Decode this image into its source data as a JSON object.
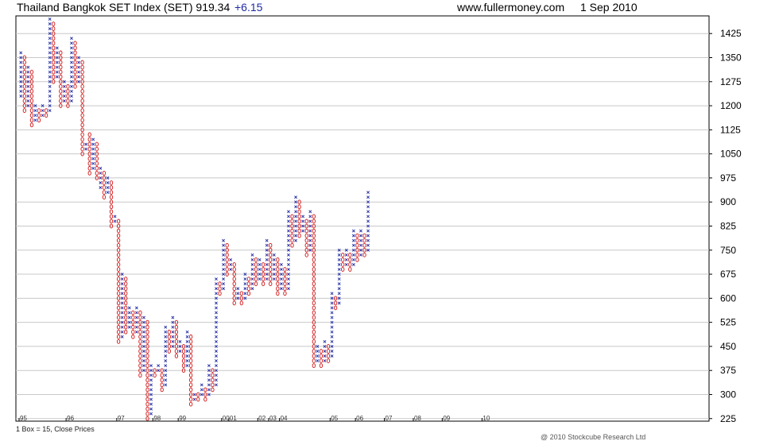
{
  "header": {
    "title": "Thailand Bangkok SET Index (SET) 919.34",
    "change": "+6.15",
    "source": "www.fullermoney.com",
    "date": "1 Sep 2010"
  },
  "footer": {
    "box_note": "1 Box = 15, Close Prices",
    "copyright": "@ 2010 Stockcube Research Ltd"
  },
  "colors": {
    "x_col": "#1f2aa3",
    "o_col": "#d01010",
    "grid": "#c8c8c8",
    "axis": "#000000"
  },
  "chart_data": {
    "type": "point-and-figure",
    "box_size": 15,
    "ylim": [
      217,
      1480
    ],
    "y_ticks": [
      225,
      300,
      375,
      450,
      525,
      600,
      675,
      750,
      825,
      900,
      975,
      1050,
      1125,
      1200,
      1275,
      1350,
      1425
    ],
    "x_ticks": [
      "95",
      "96",
      "97",
      "98",
      "99",
      "00",
      "01",
      "02",
      "03",
      "04",
      "05",
      "06",
      "07",
      "08",
      "09",
      "10"
    ],
    "x_tick_col": [
      0,
      13,
      27,
      37,
      44,
      56,
      58,
      66,
      69,
      72,
      86,
      93,
      101,
      109,
      117,
      128
    ],
    "columns": [
      {
        "type": "X",
        "low": 1230,
        "high": 1365
      },
      {
        "type": "O",
        "low": 1185,
        "high": 1350
      },
      {
        "type": "X",
        "low": 1200,
        "high": 1320
      },
      {
        "type": "O",
        "low": 1140,
        "high": 1305
      },
      {
        "type": "X",
        "low": 1155,
        "high": 1200
      },
      {
        "type": "O",
        "low": 1155,
        "high": 1185
      },
      {
        "type": "X",
        "low": 1170,
        "high": 1200
      },
      {
        "type": "O",
        "low": 1170,
        "high": 1185
      },
      {
        "type": "X",
        "low": 1185,
        "high": 1470
      },
      {
        "type": "O",
        "low": 1275,
        "high": 1455
      },
      {
        "type": "X",
        "low": 1290,
        "high": 1380
      },
      {
        "type": "O",
        "low": 1200,
        "high": 1365
      },
      {
        "type": "X",
        "low": 1215,
        "high": 1275
      },
      {
        "type": "O",
        "low": 1200,
        "high": 1260
      },
      {
        "type": "X",
        "low": 1215,
        "high": 1410
      },
      {
        "type": "O",
        "low": 1260,
        "high": 1395
      },
      {
        "type": "X",
        "low": 1275,
        "high": 1350
      },
      {
        "type": "O",
        "low": 1050,
        "high": 1335
      },
      {
        "type": "X",
        "low": 1065,
        "high": 1080
      },
      {
        "type": "O",
        "low": 990,
        "high": 1110
      },
      {
        "type": "X",
        "low": 1005,
        "high": 1095
      },
      {
        "type": "O",
        "low": 975,
        "high": 1080
      },
      {
        "type": "X",
        "low": 945,
        "high": 1005
      },
      {
        "type": "O",
        "low": 915,
        "high": 990
      },
      {
        "type": "X",
        "low": 930,
        "high": 975
      },
      {
        "type": "O",
        "low": 825,
        "high": 960
      },
      {
        "type": "X",
        "low": 840,
        "high": 855
      },
      {
        "type": "O",
        "low": 465,
        "high": 840
      },
      {
        "type": "X",
        "low": 480,
        "high": 675
      },
      {
        "type": "O",
        "low": 495,
        "high": 660
      },
      {
        "type": "X",
        "low": 510,
        "high": 570
      },
      {
        "type": "O",
        "low": 480,
        "high": 555
      },
      {
        "type": "X",
        "low": 495,
        "high": 570
      },
      {
        "type": "O",
        "low": 360,
        "high": 555
      },
      {
        "type": "X",
        "low": 375,
        "high": 540
      },
      {
        "type": "O",
        "low": 225,
        "high": 525
      },
      {
        "type": "X",
        "low": 240,
        "high": 390
      },
      {
        "type": "O",
        "low": 360,
        "high": 375
      },
      {
        "type": "X",
        "low": 375,
        "high": 390
      },
      {
        "type": "O",
        "low": 315,
        "high": 375
      },
      {
        "type": "X",
        "low": 330,
        "high": 510
      },
      {
        "type": "O",
        "low": 435,
        "high": 495
      },
      {
        "type": "X",
        "low": 450,
        "high": 540
      },
      {
        "type": "O",
        "low": 420,
        "high": 525
      },
      {
        "type": "X",
        "low": 435,
        "high": 465
      },
      {
        "type": "O",
        "low": 375,
        "high": 450
      },
      {
        "type": "X",
        "low": 390,
        "high": 495
      },
      {
        "type": "O",
        "low": 270,
        "high": 480
      },
      {
        "type": "X",
        "low": 285,
        "high": 300
      },
      {
        "type": "O",
        "low": 285,
        "high": 300
      },
      {
        "type": "X",
        "low": 300,
        "high": 330
      },
      {
        "type": "O",
        "low": 285,
        "high": 315
      },
      {
        "type": "X",
        "low": 300,
        "high": 390
      },
      {
        "type": "O",
        "low": 315,
        "high": 375
      },
      {
        "type": "X",
        "low": 330,
        "high": 660
      },
      {
        "type": "O",
        "low": 615,
        "high": 645
      },
      {
        "type": "X",
        "low": 630,
        "high": 780
      },
      {
        "type": "O",
        "low": 675,
        "high": 765
      },
      {
        "type": "X",
        "low": 690,
        "high": 720
      },
      {
        "type": "O",
        "low": 585,
        "high": 705
      },
      {
        "type": "X",
        "low": 600,
        "high": 630
      },
      {
        "type": "O",
        "low": 585,
        "high": 615
      },
      {
        "type": "X",
        "low": 600,
        "high": 675
      },
      {
        "type": "O",
        "low": 615,
        "high": 660
      },
      {
        "type": "X",
        "low": 630,
        "high": 735
      },
      {
        "type": "O",
        "low": 645,
        "high": 720
      },
      {
        "type": "X",
        "low": 660,
        "high": 720
      },
      {
        "type": "O",
        "low": 645,
        "high": 705
      },
      {
        "type": "X",
        "low": 660,
        "high": 780
      },
      {
        "type": "O",
        "low": 645,
        "high": 765
      },
      {
        "type": "X",
        "low": 660,
        "high": 735
      },
      {
        "type": "O",
        "low": 615,
        "high": 720
      },
      {
        "type": "X",
        "low": 630,
        "high": 705
      },
      {
        "type": "O",
        "low": 615,
        "high": 690
      },
      {
        "type": "X",
        "low": 630,
        "high": 870
      },
      {
        "type": "O",
        "low": 765,
        "high": 855
      },
      {
        "type": "X",
        "low": 780,
        "high": 915
      },
      {
        "type": "O",
        "low": 795,
        "high": 900
      },
      {
        "type": "X",
        "low": 810,
        "high": 855
      },
      {
        "type": "O",
        "low": 735,
        "high": 840
      },
      {
        "type": "X",
        "low": 750,
        "high": 870
      },
      {
        "type": "O",
        "low": 390,
        "high": 855
      },
      {
        "type": "X",
        "low": 405,
        "high": 450
      },
      {
        "type": "O",
        "low": 390,
        "high": 435
      },
      {
        "type": "X",
        "low": 405,
        "high": 465
      },
      {
        "type": "O",
        "low": 405,
        "high": 450
      },
      {
        "type": "X",
        "low": 420,
        "high": 615
      },
      {
        "type": "O",
        "low": 570,
        "high": 600
      },
      {
        "type": "X",
        "low": 585,
        "high": 750
      },
      {
        "type": "O",
        "low": 690,
        "high": 735
      },
      {
        "type": "X",
        "low": 705,
        "high": 750
      },
      {
        "type": "O",
        "low": 690,
        "high": 735
      },
      {
        "type": "X",
        "low": 705,
        "high": 810
      },
      {
        "type": "O",
        "low": 720,
        "high": 795
      },
      {
        "type": "X",
        "low": 735,
        "high": 810
      },
      {
        "type": "O",
        "low": 735,
        "high": 795
      },
      {
        "type": "X",
        "low": 750,
        "high": 930
      }
    ]
  }
}
